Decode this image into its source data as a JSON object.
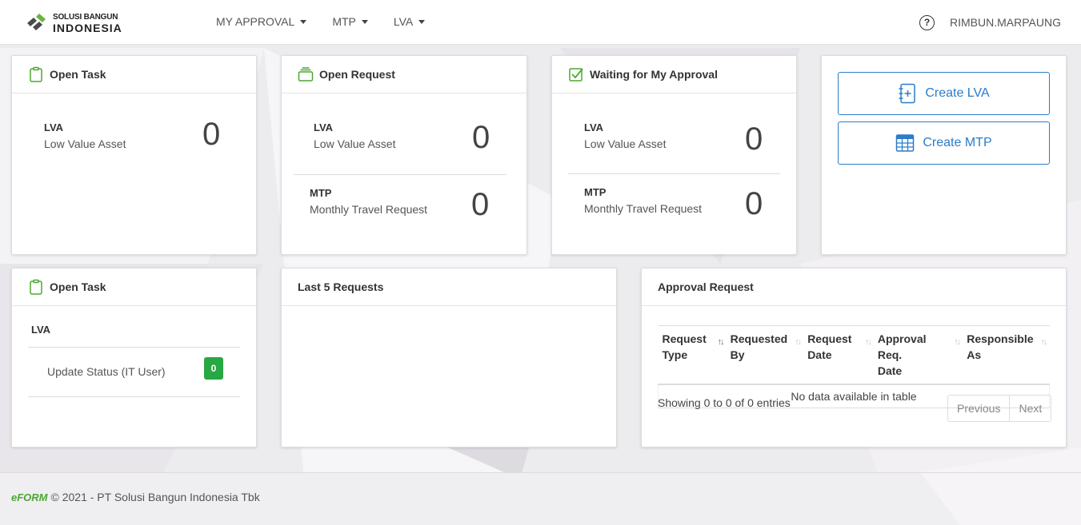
{
  "brand": {
    "line1": "SOLUSI BANGUN",
    "line2": "INDONESIA",
    "logo_colors": {
      "green": "#6cb33e",
      "dark": "#4a4a4a"
    }
  },
  "nav": {
    "items": [
      {
        "label": "MY APPROVAL"
      },
      {
        "label": "MTP"
      },
      {
        "label": "LVA"
      }
    ],
    "help_glyph": "?",
    "user": "RIMBUN.MARPAUNG"
  },
  "open_task_card": {
    "title": "Open Task",
    "icon": "clipboard-icon",
    "rows": [
      {
        "code": "LVA",
        "desc": "Low Value Asset",
        "count": "0"
      }
    ]
  },
  "open_request_card": {
    "title": "Open Request",
    "icon": "stack-icon",
    "rows": [
      {
        "code": "LVA",
        "desc": "Low Value Asset",
        "count": "0"
      },
      {
        "code": "MTP",
        "desc": "Monthly Travel Request",
        "count": "0"
      }
    ]
  },
  "waiting_card": {
    "title": "Waiting for My Approval",
    "icon": "check-square-icon",
    "rows": [
      {
        "code": "LVA",
        "desc": "Low Value Asset",
        "count": "0"
      },
      {
        "code": "MTP",
        "desc": "Monthly Travel Request",
        "count": "0"
      }
    ]
  },
  "actions": {
    "create_lva": "Create LVA",
    "create_mtp": "Create MTP",
    "accent": "#2b7cc9"
  },
  "open_task_detail": {
    "title": "Open Task",
    "group": "LVA",
    "item_label": "Update Status (IT User)",
    "item_count": "0",
    "badge_color": "#28a745"
  },
  "last_requests": {
    "title": "Last 5 Requests"
  },
  "approval_request": {
    "title": "Approval Request",
    "columns": [
      {
        "line1": "Request",
        "line2": "Type"
      },
      {
        "line1": "Requested",
        "line2": "By"
      },
      {
        "line1": "Request",
        "line2": "Date"
      },
      {
        "line1": "Approval Req.",
        "line2": "Date"
      },
      {
        "line1": "Responsible",
        "line2": "As"
      }
    ],
    "empty_message": "No data available in table",
    "info": "Showing 0 to 0 of 0 entries",
    "prev": "Previous",
    "next": "Next"
  },
  "footer": {
    "brand": "eFORM",
    "text": "© 2021 - PT Solusi Bangun Indonesia Tbk"
  }
}
